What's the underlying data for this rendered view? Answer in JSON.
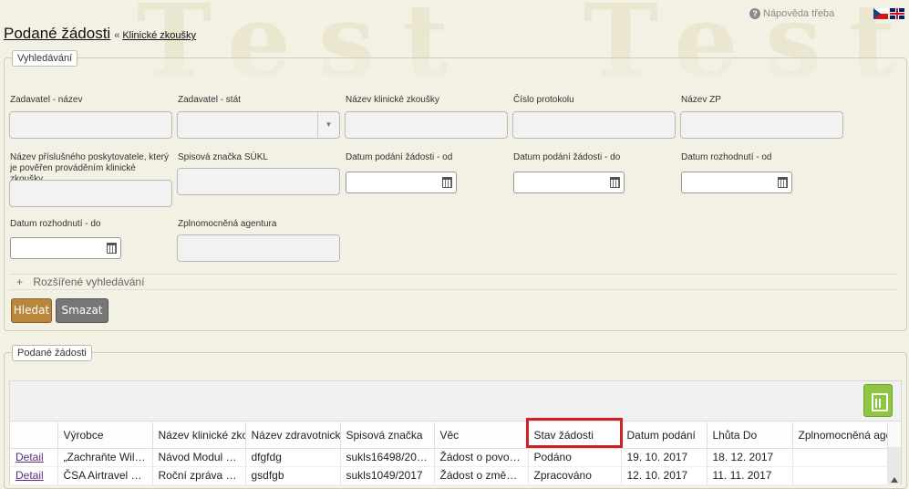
{
  "watermark": "Test",
  "header": {
    "help_label": "Nápověda třeba",
    "help_icon": "question-circle-icon",
    "lang_flags": [
      "flag-cz",
      "flag-uk"
    ],
    "page_title": "Podané žádosti",
    "breadcrumb_sep": "«",
    "breadcrumb_link": "Klinické zkoušky"
  },
  "search": {
    "legend": "Vyhledávání",
    "fields": {
      "zadavatel_nazev": {
        "label": "Zadavatel - název",
        "value": ""
      },
      "zadavatel_stat": {
        "label": "Zadavatel - stát",
        "value": ""
      },
      "nazev_kz": {
        "label": "Název klinické zkoušky",
        "value": ""
      },
      "cislo_protokolu": {
        "label": "Číslo protokolu",
        "value": ""
      },
      "nazev_zp": {
        "label": "Název ZP",
        "value": ""
      },
      "poskytovatel": {
        "label": "Název příslušného poskytovatele, který je pověřen prováděním klinické zkoušky",
        "value": ""
      },
      "spisova_znacka": {
        "label": "Spisová značka SÚKL",
        "value": ""
      },
      "podani_od": {
        "label": "Datum podání žádosti - od",
        "value": ""
      },
      "podani_do": {
        "label": "Datum podání žádosti - do",
        "value": ""
      },
      "rozhodnuti_od": {
        "label": "Datum rozhodnutí - od",
        "value": ""
      },
      "rozhodnuti_do": {
        "label": "Datum rozhodnutí - do",
        "value": ""
      },
      "agentura": {
        "label": "Zplnomocněná agentura",
        "value": ""
      }
    },
    "advanced_symbol": "+",
    "advanced_label": "Rozšířené vyhledávání",
    "search_button": "Hledat",
    "clear_button": "Smazat"
  },
  "results": {
    "legend": "Podané žádosti",
    "export_icon": "export-excel-icon",
    "columns": [
      "",
      "Výrobce",
      "Název klinické zkouška",
      "Název zdravotnického",
      "Spisová značka",
      "Věc",
      "Stav žádosti",
      "Datum podání",
      "Lhůta Do",
      "Zplnomocněná agentura"
    ],
    "rows": [
      [
        "Detail",
        "„Zachraňte Williho\"",
        "Návod Modul KZ",
        "dfgfdg",
        "sukls16498/2017",
        "Žádost o povolení klinické zkoušky",
        "Podáno",
        "19. 10. 2017",
        "18. 12. 2017",
        ""
      ],
      [
        "Detail",
        "ČSA Airtravel a.s.",
        "Roční zpráva - zpráva",
        "gsdfgb",
        "sukls1049/2017",
        "Žádost o změnu KZ",
        "Zpracováno",
        "12. 10. 2017",
        "11. 11. 2017",
        ""
      ]
    ]
  }
}
